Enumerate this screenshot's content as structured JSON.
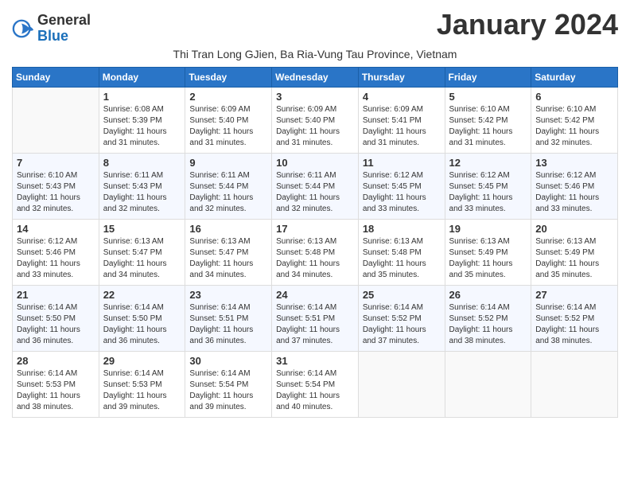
{
  "logo": {
    "general": "General",
    "blue": "Blue"
  },
  "title": "January 2024",
  "subtitle": "Thi Tran Long GJien, Ba Ria-Vung Tau Province, Vietnam",
  "days_of_week": [
    "Sunday",
    "Monday",
    "Tuesday",
    "Wednesday",
    "Thursday",
    "Friday",
    "Saturday"
  ],
  "weeks": [
    [
      {
        "day": "",
        "sunrise": "",
        "sunset": "",
        "daylight": ""
      },
      {
        "day": "1",
        "sunrise": "Sunrise: 6:08 AM",
        "sunset": "Sunset: 5:39 PM",
        "daylight": "Daylight: 11 hours and 31 minutes."
      },
      {
        "day": "2",
        "sunrise": "Sunrise: 6:09 AM",
        "sunset": "Sunset: 5:40 PM",
        "daylight": "Daylight: 11 hours and 31 minutes."
      },
      {
        "day": "3",
        "sunrise": "Sunrise: 6:09 AM",
        "sunset": "Sunset: 5:40 PM",
        "daylight": "Daylight: 11 hours and 31 minutes."
      },
      {
        "day": "4",
        "sunrise": "Sunrise: 6:09 AM",
        "sunset": "Sunset: 5:41 PM",
        "daylight": "Daylight: 11 hours and 31 minutes."
      },
      {
        "day": "5",
        "sunrise": "Sunrise: 6:10 AM",
        "sunset": "Sunset: 5:42 PM",
        "daylight": "Daylight: 11 hours and 31 minutes."
      },
      {
        "day": "6",
        "sunrise": "Sunrise: 6:10 AM",
        "sunset": "Sunset: 5:42 PM",
        "daylight": "Daylight: 11 hours and 32 minutes."
      }
    ],
    [
      {
        "day": "7",
        "sunrise": "Sunrise: 6:10 AM",
        "sunset": "Sunset: 5:43 PM",
        "daylight": "Daylight: 11 hours and 32 minutes."
      },
      {
        "day": "8",
        "sunrise": "Sunrise: 6:11 AM",
        "sunset": "Sunset: 5:43 PM",
        "daylight": "Daylight: 11 hours and 32 minutes."
      },
      {
        "day": "9",
        "sunrise": "Sunrise: 6:11 AM",
        "sunset": "Sunset: 5:44 PM",
        "daylight": "Daylight: 11 hours and 32 minutes."
      },
      {
        "day": "10",
        "sunrise": "Sunrise: 6:11 AM",
        "sunset": "Sunset: 5:44 PM",
        "daylight": "Daylight: 11 hours and 32 minutes."
      },
      {
        "day": "11",
        "sunrise": "Sunrise: 6:12 AM",
        "sunset": "Sunset: 5:45 PM",
        "daylight": "Daylight: 11 hours and 33 minutes."
      },
      {
        "day": "12",
        "sunrise": "Sunrise: 6:12 AM",
        "sunset": "Sunset: 5:45 PM",
        "daylight": "Daylight: 11 hours and 33 minutes."
      },
      {
        "day": "13",
        "sunrise": "Sunrise: 6:12 AM",
        "sunset": "Sunset: 5:46 PM",
        "daylight": "Daylight: 11 hours and 33 minutes."
      }
    ],
    [
      {
        "day": "14",
        "sunrise": "Sunrise: 6:12 AM",
        "sunset": "Sunset: 5:46 PM",
        "daylight": "Daylight: 11 hours and 33 minutes."
      },
      {
        "day": "15",
        "sunrise": "Sunrise: 6:13 AM",
        "sunset": "Sunset: 5:47 PM",
        "daylight": "Daylight: 11 hours and 34 minutes."
      },
      {
        "day": "16",
        "sunrise": "Sunrise: 6:13 AM",
        "sunset": "Sunset: 5:47 PM",
        "daylight": "Daylight: 11 hours and 34 minutes."
      },
      {
        "day": "17",
        "sunrise": "Sunrise: 6:13 AM",
        "sunset": "Sunset: 5:48 PM",
        "daylight": "Daylight: 11 hours and 34 minutes."
      },
      {
        "day": "18",
        "sunrise": "Sunrise: 6:13 AM",
        "sunset": "Sunset: 5:48 PM",
        "daylight": "Daylight: 11 hours and 35 minutes."
      },
      {
        "day": "19",
        "sunrise": "Sunrise: 6:13 AM",
        "sunset": "Sunset: 5:49 PM",
        "daylight": "Daylight: 11 hours and 35 minutes."
      },
      {
        "day": "20",
        "sunrise": "Sunrise: 6:13 AM",
        "sunset": "Sunset: 5:49 PM",
        "daylight": "Daylight: 11 hours and 35 minutes."
      }
    ],
    [
      {
        "day": "21",
        "sunrise": "Sunrise: 6:14 AM",
        "sunset": "Sunset: 5:50 PM",
        "daylight": "Daylight: 11 hours and 36 minutes."
      },
      {
        "day": "22",
        "sunrise": "Sunrise: 6:14 AM",
        "sunset": "Sunset: 5:50 PM",
        "daylight": "Daylight: 11 hours and 36 minutes."
      },
      {
        "day": "23",
        "sunrise": "Sunrise: 6:14 AM",
        "sunset": "Sunset: 5:51 PM",
        "daylight": "Daylight: 11 hours and 36 minutes."
      },
      {
        "day": "24",
        "sunrise": "Sunrise: 6:14 AM",
        "sunset": "Sunset: 5:51 PM",
        "daylight": "Daylight: 11 hours and 37 minutes."
      },
      {
        "day": "25",
        "sunrise": "Sunrise: 6:14 AM",
        "sunset": "Sunset: 5:52 PM",
        "daylight": "Daylight: 11 hours and 37 minutes."
      },
      {
        "day": "26",
        "sunrise": "Sunrise: 6:14 AM",
        "sunset": "Sunset: 5:52 PM",
        "daylight": "Daylight: 11 hours and 38 minutes."
      },
      {
        "day": "27",
        "sunrise": "Sunrise: 6:14 AM",
        "sunset": "Sunset: 5:52 PM",
        "daylight": "Daylight: 11 hours and 38 minutes."
      }
    ],
    [
      {
        "day": "28",
        "sunrise": "Sunrise: 6:14 AM",
        "sunset": "Sunset: 5:53 PM",
        "daylight": "Daylight: 11 hours and 38 minutes."
      },
      {
        "day": "29",
        "sunrise": "Sunrise: 6:14 AM",
        "sunset": "Sunset: 5:53 PM",
        "daylight": "Daylight: 11 hours and 39 minutes."
      },
      {
        "day": "30",
        "sunrise": "Sunrise: 6:14 AM",
        "sunset": "Sunset: 5:54 PM",
        "daylight": "Daylight: 11 hours and 39 minutes."
      },
      {
        "day": "31",
        "sunrise": "Sunrise: 6:14 AM",
        "sunset": "Sunset: 5:54 PM",
        "daylight": "Daylight: 11 hours and 40 minutes."
      },
      {
        "day": "",
        "sunrise": "",
        "sunset": "",
        "daylight": ""
      },
      {
        "day": "",
        "sunrise": "",
        "sunset": "",
        "daylight": ""
      },
      {
        "day": "",
        "sunrise": "",
        "sunset": "",
        "daylight": ""
      }
    ]
  ]
}
